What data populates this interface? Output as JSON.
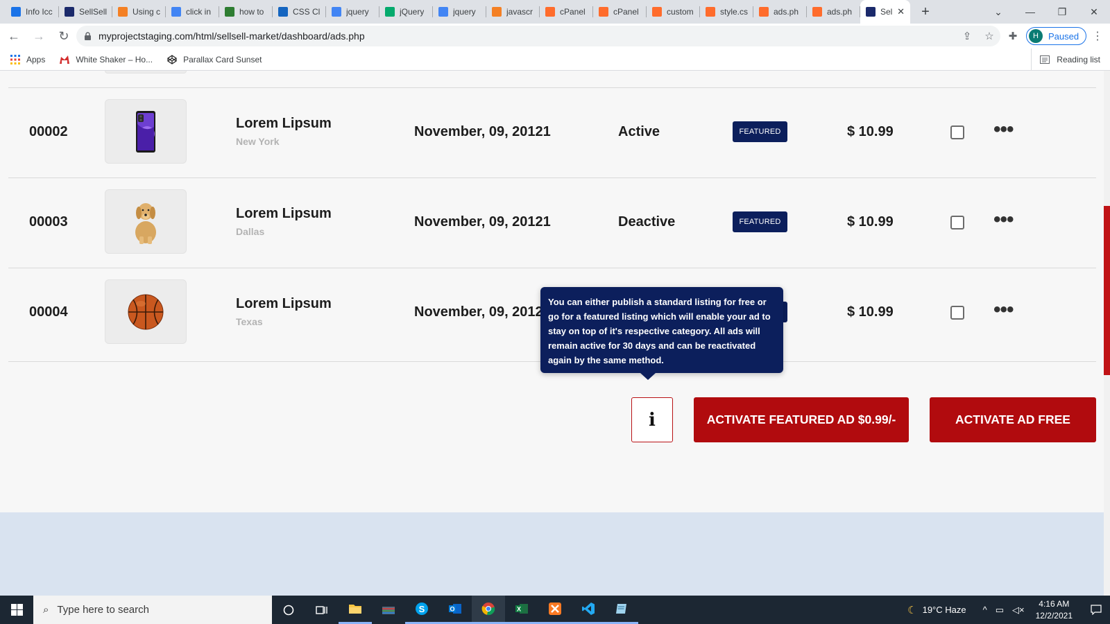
{
  "browser": {
    "tabs": [
      {
        "title": "Info Icc",
        "icon": "flag-icon",
        "color": "#1a73e8"
      },
      {
        "title": "SellSell",
        "icon": "sellsell-logo-icon",
        "color": "#1b2a6b"
      },
      {
        "title": "Using c",
        "icon": "stackoverflow-icon",
        "color": "#f48024"
      },
      {
        "title": "click in",
        "icon": "google-icon",
        "color": "#4285f4"
      },
      {
        "title": "how to",
        "icon": "tool-icon",
        "color": "#2e7d32"
      },
      {
        "title": "CSS Cli",
        "icon": "css-icon",
        "color": "#1565c0"
      },
      {
        "title": "jquery",
        "icon": "google-icon",
        "color": "#4285f4"
      },
      {
        "title": "jQuery",
        "icon": "w3schools-icon",
        "color": "#04aa6d"
      },
      {
        "title": "jquery",
        "icon": "google-icon",
        "color": "#4285f4"
      },
      {
        "title": "javascr",
        "icon": "stackoverflow-icon",
        "color": "#f48024"
      },
      {
        "title": "cPanel",
        "icon": "cpanel-icon",
        "color": "#ff6c2c"
      },
      {
        "title": "cPanel",
        "icon": "cpanel-icon",
        "color": "#ff6c2c"
      },
      {
        "title": "custom",
        "icon": "cpanel-icon",
        "color": "#ff6c2c"
      },
      {
        "title": "style.cs",
        "icon": "cpanel-icon",
        "color": "#ff6c2c"
      },
      {
        "title": "ads.ph",
        "icon": "cpanel-icon",
        "color": "#ff6c2c"
      },
      {
        "title": "ads.ph",
        "icon": "cpanel-icon",
        "color": "#ff6c2c"
      }
    ],
    "active_tab": {
      "title": "Sel",
      "icon": "sellsell-logo-icon",
      "close": "✕"
    },
    "new_tab": "+",
    "url": "myprojectstaging.com/html/sellsell-market/dashboard/ads.php",
    "profile": {
      "initial": "H",
      "status": "Paused"
    },
    "bookmarks": [
      {
        "label": "Apps",
        "icon": "apps-grid-icon"
      },
      {
        "label": "White Shaker – Ho...",
        "icon": "home-store-icon"
      },
      {
        "label": "Parallax Card Sunset",
        "icon": "codepen-icon"
      }
    ],
    "reading_list": "Reading list"
  },
  "ads": {
    "rows": [
      {
        "id": "00002",
        "title": "Lorem Lipsum",
        "location": "New York",
        "date": "November, 09, 20121",
        "status": "Active",
        "badge": "FEATURED",
        "price": "$ 10.99",
        "image": "phone"
      },
      {
        "id": "00003",
        "title": "Lorem Lipsum",
        "location": "Dallas",
        "date": "November, 09, 20121",
        "status": "Deactive",
        "badge": "FEATURED",
        "price": "$ 10.99",
        "image": "dog"
      },
      {
        "id": "00004",
        "title": "Lorem Lipsum",
        "location": "Texas",
        "date": "November, 09, 2012",
        "status": "",
        "badge": "",
        "price": "$ 10.99",
        "image": "basketball"
      }
    ],
    "more_glyph": "•••"
  },
  "tooltip": {
    "text": "You can either publish a standard listing for free or go for a featured listing which will enable your ad to stay on top of it's respective category. All ads will remain active for 30 days and can be reactivated again by the same method."
  },
  "actions": {
    "info_label": "i",
    "featured_label": "ACTIVATE FEATURED AD $0.99/-",
    "free_label": "ACTIVATE AD FREE"
  },
  "taskbar": {
    "search_placeholder": "Type here to search",
    "weather": "19°C  Haze",
    "time": "4:16 AM",
    "date": "12/2/2021"
  },
  "colors": {
    "brand_red": "#b10b0e",
    "navy": "#0c1f5c",
    "footer_band": "#d9e3f0"
  }
}
